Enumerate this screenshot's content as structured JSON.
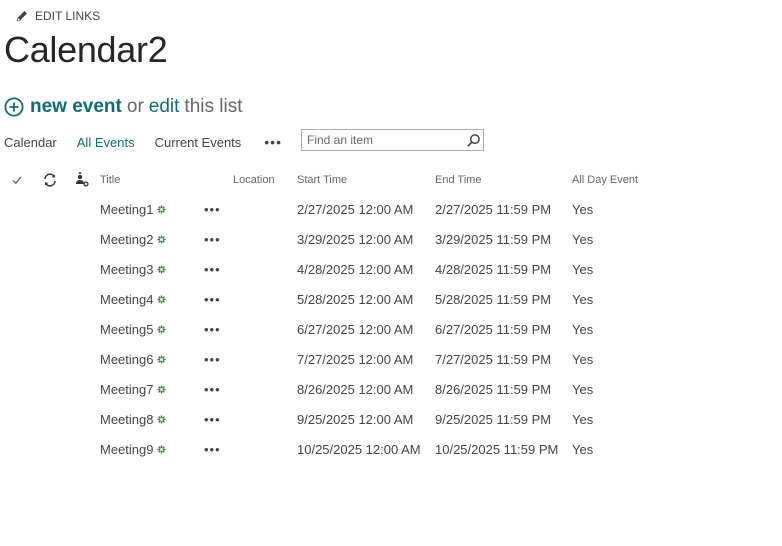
{
  "header": {
    "edit_links": "EDIT LINKS",
    "title": "Calendar2"
  },
  "actions": {
    "new_event": "new event",
    "or": "or",
    "edit": "edit",
    "this_list": "this list"
  },
  "views": {
    "tabs": [
      {
        "label": "Calendar",
        "selected": false
      },
      {
        "label": "All Events",
        "selected": true
      },
      {
        "label": "Current Events",
        "selected": false
      }
    ],
    "more": "•••"
  },
  "search": {
    "placeholder": "Find an item",
    "value": ""
  },
  "table": {
    "columns": {
      "title": "Title",
      "location": "Location",
      "start": "Start Time",
      "end": "End Time",
      "all_day": "All Day Event"
    },
    "row_menu": "•••",
    "rows": [
      {
        "title": "Meeting1",
        "location": "",
        "start": "2/27/2025 12:00 AM",
        "end": "2/27/2025 11:59 PM",
        "all_day": "Yes"
      },
      {
        "title": "Meeting2",
        "location": "",
        "start": "3/29/2025 12:00 AM",
        "end": "3/29/2025 11:59 PM",
        "all_day": "Yes"
      },
      {
        "title": "Meeting3",
        "location": "",
        "start": "4/28/2025 12:00 AM",
        "end": "4/28/2025 11:59 PM",
        "all_day": "Yes"
      },
      {
        "title": "Meeting4",
        "location": "",
        "start": "5/28/2025 12:00 AM",
        "end": "5/28/2025 11:59 PM",
        "all_day": "Yes"
      },
      {
        "title": "Meeting5",
        "location": "",
        "start": "6/27/2025 12:00 AM",
        "end": "6/27/2025 11:59 PM",
        "all_day": "Yes"
      },
      {
        "title": "Meeting6",
        "location": "",
        "start": "7/27/2025 12:00 AM",
        "end": "7/27/2025 11:59 PM",
        "all_day": "Yes"
      },
      {
        "title": "Meeting7",
        "location": "",
        "start": "8/26/2025 12:00 AM",
        "end": "8/26/2025 11:59 PM",
        "all_day": "Yes"
      },
      {
        "title": "Meeting8",
        "location": "",
        "start": "9/25/2025 12:00 AM",
        "end": "9/25/2025 11:59 PM",
        "all_day": "Yes"
      },
      {
        "title": "Meeting9",
        "location": "",
        "start": "10/25/2025 12:00 AM",
        "end": "10/25/2025 11:59 PM",
        "all_day": "Yes"
      }
    ]
  },
  "icons": {
    "edit_links": "pencil-icon",
    "new_event": "plus-circle-icon",
    "search": "search-icon",
    "select_all": "checkmark-icon",
    "sync": "sync-icon",
    "share": "share-people-icon",
    "new_item": "new-item-sparkle-icon"
  },
  "colors": {
    "accent": "#0f6b75",
    "text": "#444444",
    "new_badge": "#2d8c2d"
  }
}
